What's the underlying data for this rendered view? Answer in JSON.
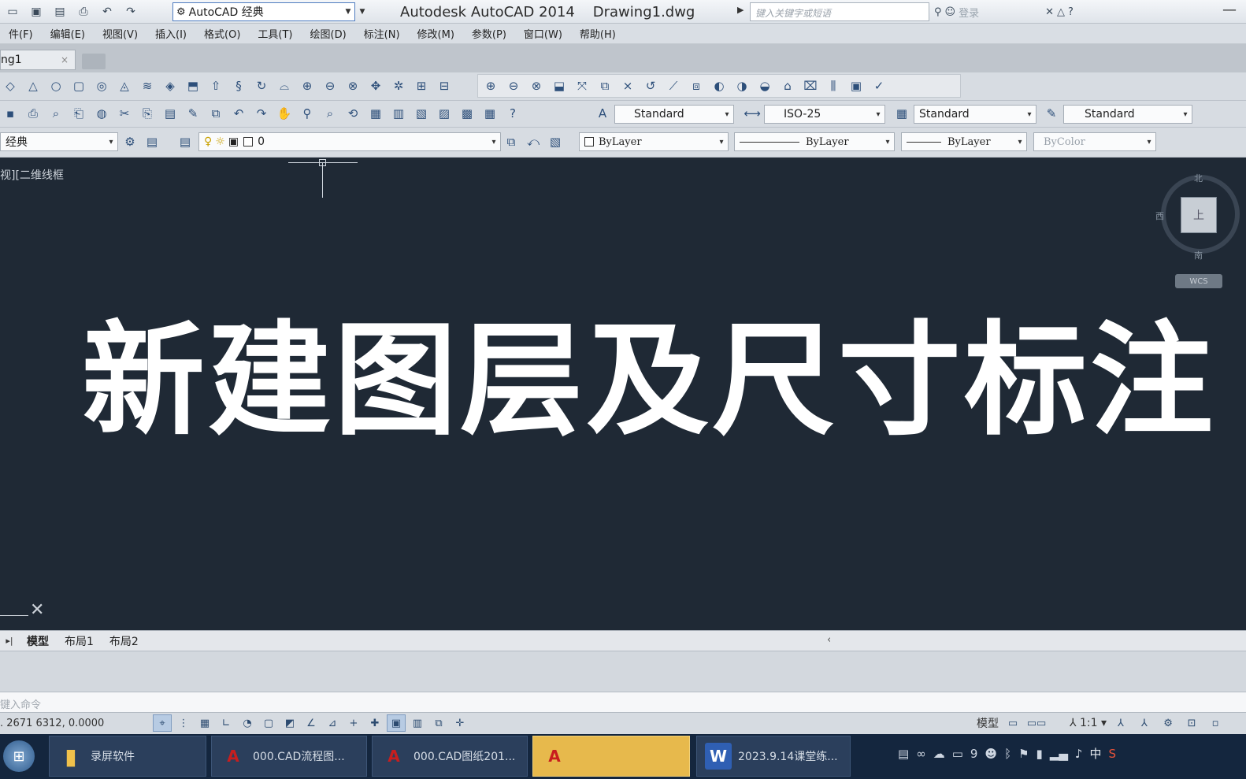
{
  "titlebar": {
    "workspace": "AutoCAD 经典",
    "app_title": "Autodesk AutoCAD 2014    Drawing1.dwg",
    "search_placeholder": "键入关键字或短语",
    "signin": "登录"
  },
  "menu": [
    "件(F)",
    "编辑(E)",
    "视图(V)",
    "插入(I)",
    "格式(O)",
    "工具(T)",
    "绘图(D)",
    "标注(N)",
    "修改(M)",
    "参数(P)",
    "窗口(W)",
    "帮助(H)"
  ],
  "document_tab": {
    "label": "ng1"
  },
  "styles": {
    "text_style": "Standard",
    "dim_style": "ISO-25",
    "table_style": "Standard",
    "multileader_style": "Standard"
  },
  "properties": {
    "workspace_small": "经典",
    "layer": "0",
    "color": "ByLayer",
    "linetype": "ByLayer",
    "lineweight": "ByLayer",
    "plotstyle": "ByColor"
  },
  "canvas": {
    "viewport_label": "视][二维线框",
    "overlay_title": "新建图层及尺寸标注",
    "viewcube_face": "上",
    "viewcube_north": "北",
    "viewcube_west": "西",
    "viewcube_south": "南",
    "wcs": "WCS"
  },
  "layout_tabs": [
    "模型",
    "布局1",
    "布局2"
  ],
  "command_prompt": "键入命令",
  "status": {
    "coords": ". 2671 6312, 0.0000",
    "model_label": "模型",
    "annotation_scale": "1:1"
  },
  "taskbar": {
    "tasks": [
      "录屏软件",
      "000.CAD流程图...",
      "000.CAD图纸201...",
      "",
      "2023.9.14课堂练..."
    ],
    "ime": "中"
  }
}
